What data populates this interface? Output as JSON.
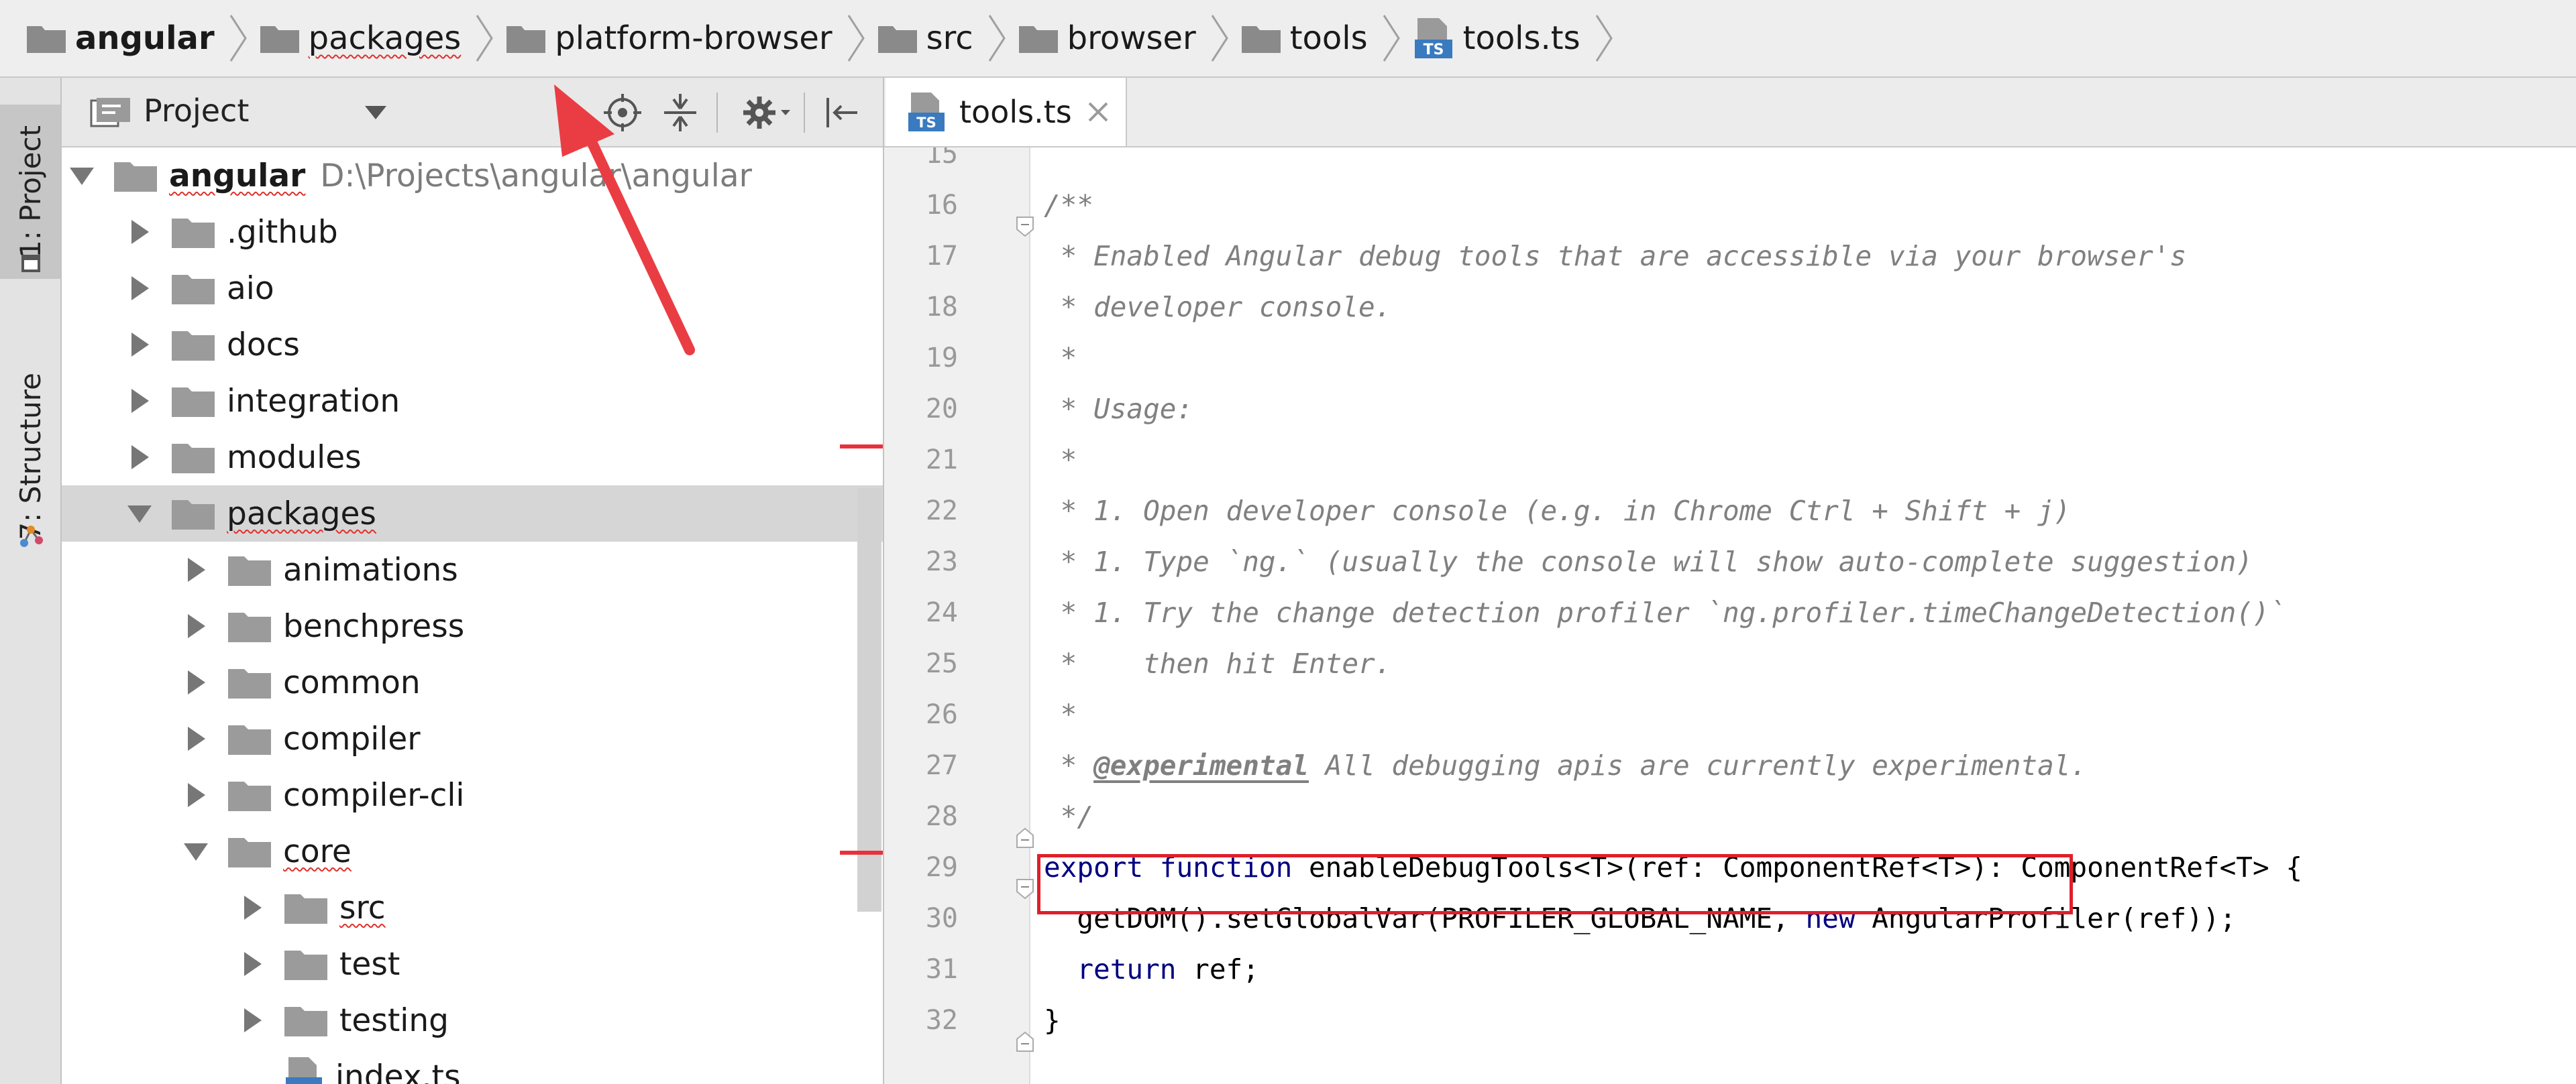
{
  "breadcrumb": {
    "items": [
      {
        "label": "angular",
        "icon": "folder-icon"
      },
      {
        "label": "packages",
        "icon": "folder-icon"
      },
      {
        "label": "platform-browser",
        "icon": "folder-icon"
      },
      {
        "label": "src",
        "icon": "folder-icon"
      },
      {
        "label": "browser",
        "icon": "folder-icon"
      },
      {
        "label": "tools",
        "icon": "folder-icon"
      },
      {
        "label": "tools.ts",
        "icon": "typescript-file-icon"
      }
    ]
  },
  "side_strip": {
    "project_tab": "1: Project",
    "structure_tab": "7: Structure"
  },
  "project_panel": {
    "title": "Project",
    "tree": [
      {
        "label": "angular",
        "path": "D:\\Projects\\angular\\angular"
      },
      {
        "label": ".github"
      },
      {
        "label": "aio"
      },
      {
        "label": "docs"
      },
      {
        "label": "integration"
      },
      {
        "label": "modules"
      },
      {
        "label": "packages"
      },
      {
        "label": "animations"
      },
      {
        "label": "benchpress"
      },
      {
        "label": "common"
      },
      {
        "label": "compiler"
      },
      {
        "label": "compiler-cli"
      },
      {
        "label": "core"
      },
      {
        "label": "src"
      },
      {
        "label": "test"
      },
      {
        "label": "testing"
      },
      {
        "label": "index.ts"
      }
    ]
  },
  "editor": {
    "tab_label": "tools.ts",
    "line_numbers": [
      "15",
      "16",
      "17",
      "18",
      "19",
      "20",
      "21",
      "22",
      "23",
      "24",
      "25",
      "26",
      "27",
      "28",
      "29",
      "30",
      "31",
      "32"
    ],
    "lines": {
      "l16": "/**",
      "l17": " * Enabled Angular debug tools that are accessible via your browser's",
      "l18": " * developer console.",
      "l19": " *",
      "l20": " * Usage:",
      "l21": " *",
      "l22": " * 1. Open developer console (e.g. in Chrome Ctrl + Shift + j)",
      "l23": " * 1. Type `ng.` (usually the console will show auto-complete suggestion)",
      "l24": " * 1. Try the change detection profiler `ng.profiler.timeChangeDetection()`",
      "l25": " *    then hit Enter.",
      "l26": " *",
      "l27_star": " * ",
      "l27_tag": "@experimental",
      "l27_rest": " All debugging apis are currently experimental.",
      "l28": " */",
      "l29_kw1": "export",
      "l29_kw2": "function",
      "l29_rest": "enableDebugTools<T>(ref: ComponentRef<T>): ComponentRef<T> {",
      "l30_a": "  getDOM().setGlobalVar(PROFILER_GLOBAL_NAME, ",
      "l30_kw": "new",
      "l30_b": " AngularProfiler(ref));",
      "l31_kw": "  return",
      "l31_rest": " ref;",
      "l32": "}"
    }
  },
  "colors": {
    "annotation_red": "#e8313c",
    "keyword_blue": "#000080",
    "comment_gray": "#808080"
  }
}
